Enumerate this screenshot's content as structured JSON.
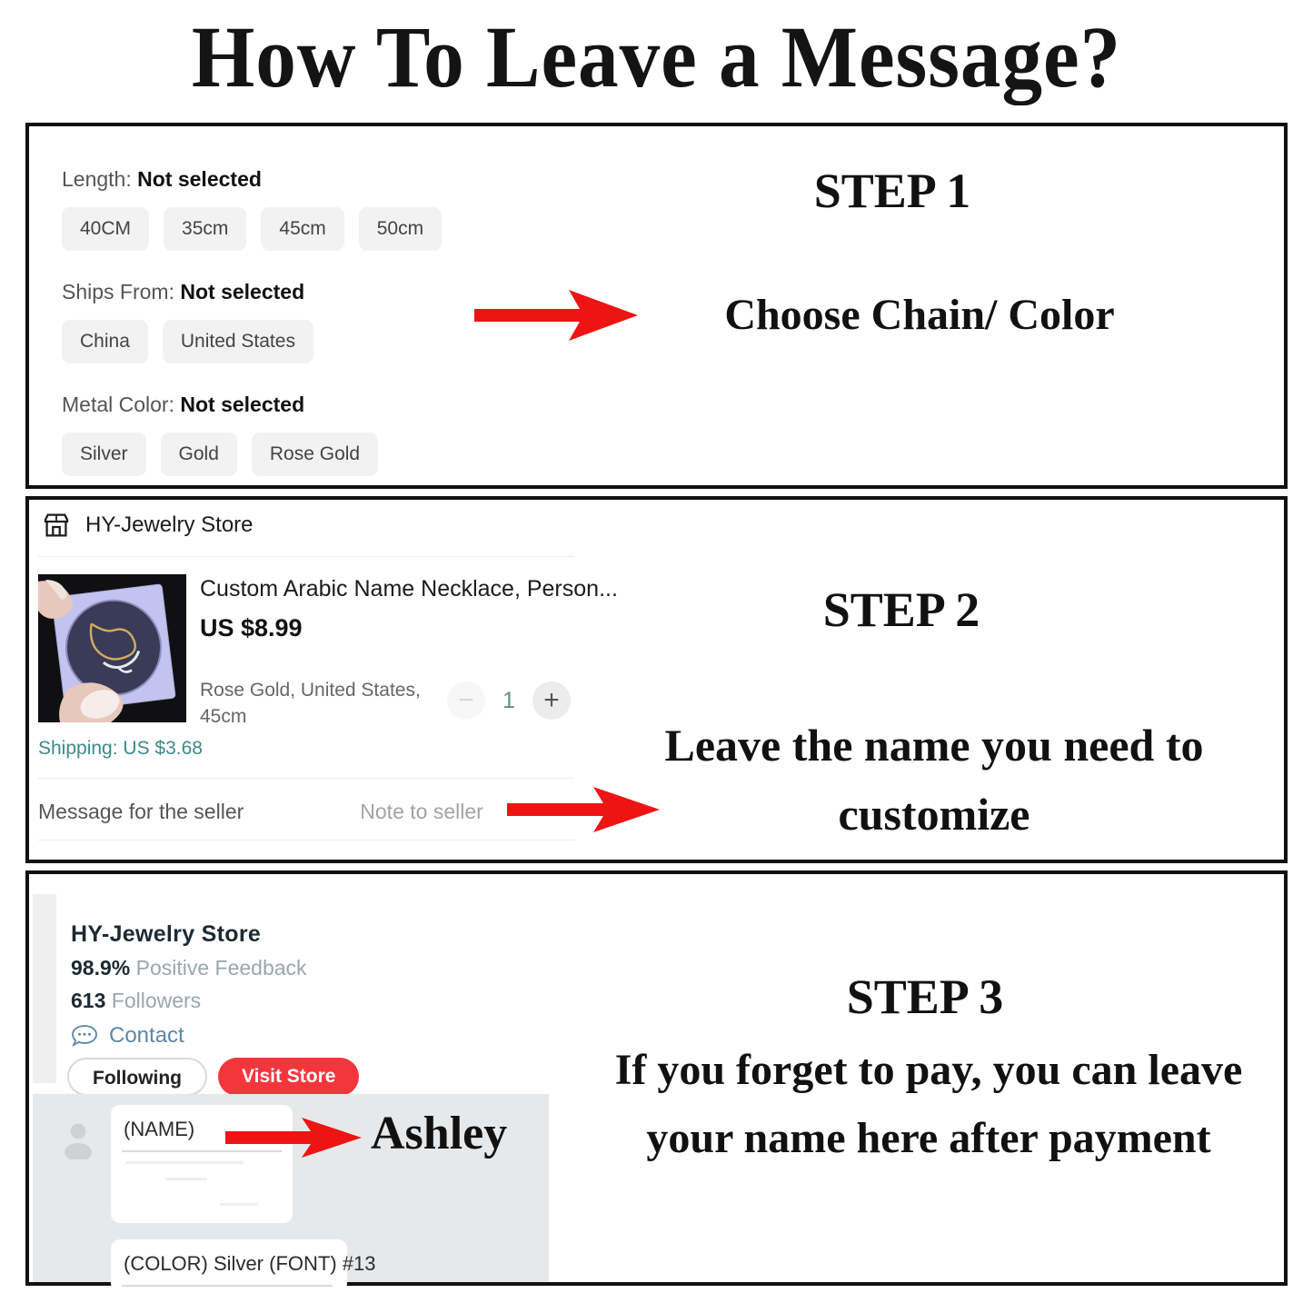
{
  "title": "How To Leave a Message?",
  "steps": [
    {
      "number": "STEP 1",
      "text": "Choose Chain/ Color"
    },
    {
      "number": "STEP 2",
      "text": "Leave the name you need to customize"
    },
    {
      "number": "STEP 3",
      "text": "If you forget to pay, you can leave your name here after payment"
    }
  ],
  "panel1": {
    "groups": [
      {
        "name": "Length:",
        "value": "Not selected",
        "icon": "length-icon",
        "options": [
          "40CM",
          "35cm",
          "45cm",
          "50cm"
        ]
      },
      {
        "name": "Ships From:",
        "value": "Not selected",
        "icon": "ship-icon",
        "options": [
          "China",
          "United States"
        ]
      },
      {
        "name": "Metal Color:",
        "value": "Not selected",
        "icon": "color-icon",
        "options": [
          "Silver",
          "Gold",
          "Rose Gold"
        ]
      }
    ]
  },
  "panel2": {
    "store_icon": "storefront-icon",
    "store_name": "HY-Jewelry Store",
    "product_title": "Custom Arabic Name Necklace, Person...",
    "product_price": "US $8.99",
    "product_variant": "Rose Gold, United States, 45cm",
    "thumbnail_alt": "hand-holding-necklace-box-photo",
    "stepper": {
      "minus_icon": "minus-icon",
      "quantity": "1",
      "plus_icon": "plus-icon"
    },
    "shipping": "Shipping: US $3.68",
    "message_label": "Message for the seller",
    "message_placeholder": "Note to seller"
  },
  "panel3": {
    "store_name": "HY-Jewelry Store",
    "feedback_value": "98.9%",
    "feedback_label": "Positive Feedback",
    "followers_value": "613",
    "followers_label": "Followers",
    "contact_icon": "chat-bubble-icon",
    "contact_label": "Contact",
    "following_button": "Following",
    "visit_button": "Visit Store",
    "avatar_icon": "user-avatar-icon",
    "chat_bubbles": [
      {
        "text": "(NAME)"
      },
      {
        "text": "(COLOR) Silver   (FONT) #13"
      }
    ],
    "highlight_name": "Ashley"
  },
  "colors": {
    "accent_red": "#ee1414",
    "visit_store_red": "#f4363c",
    "shipping_teal": "#3d8a8a",
    "contact_blue": "#5d87a8",
    "chip_bg": "#f2f2f2",
    "panel_border": "#111111",
    "chat_bg": "#e6e8ea"
  },
  "arrows": [
    {
      "name": "arrow-step-1"
    },
    {
      "name": "arrow-step-2"
    },
    {
      "name": "arrow-step-3"
    }
  ]
}
